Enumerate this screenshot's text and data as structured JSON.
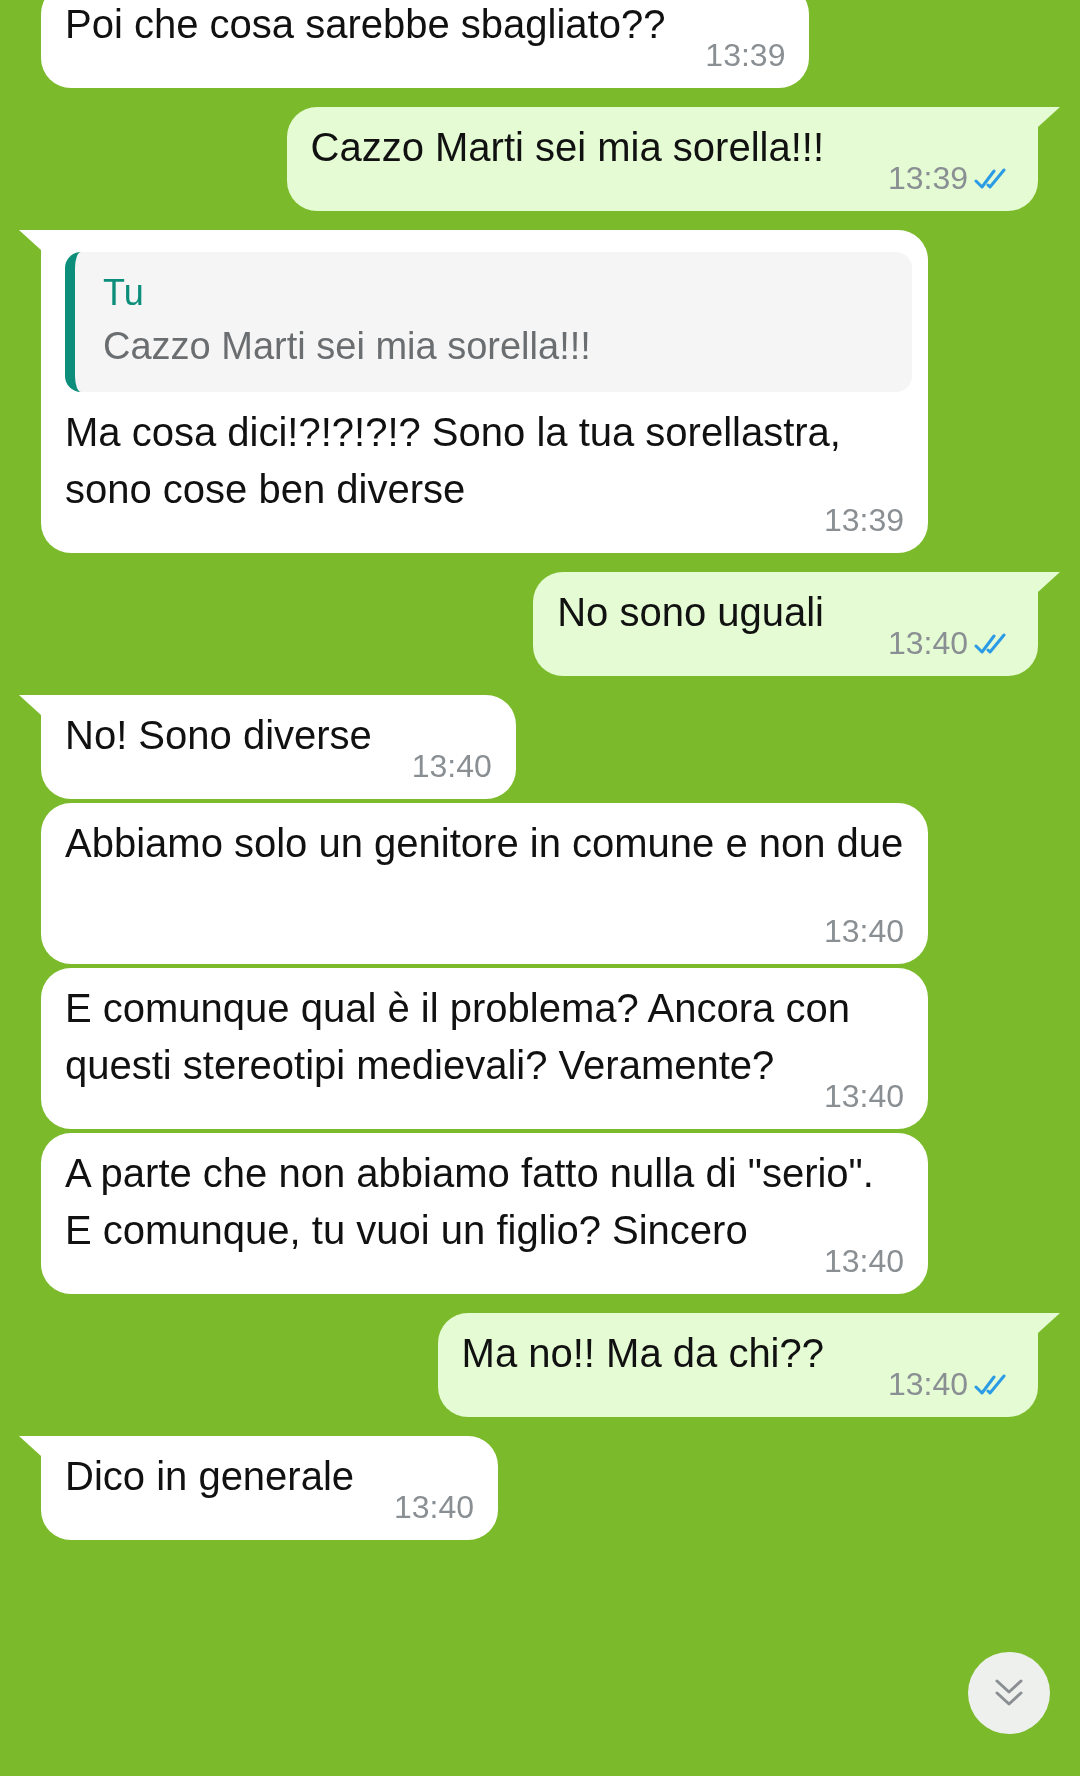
{
  "messages": [
    {
      "kind": "received",
      "tail": false,
      "text": "Poi che cosa sarebbe sbagliato??",
      "time": "13:39"
    },
    {
      "kind": "sent",
      "tail": true,
      "text": "Cazzo Marti sei mia sorella!!!",
      "time": "13:39",
      "read": true
    },
    {
      "kind": "received",
      "tail": true,
      "reply": {
        "author": "Tu",
        "text": "Cazzo Marti sei mia sorella!!!"
      },
      "text": "Ma cosa dici!?!?!?!? Sono la tua sorellastra, sono cose ben diverse",
      "time": "13:39"
    },
    {
      "kind": "sent",
      "tail": true,
      "text": "No sono uguali",
      "time": "13:40",
      "read": true
    },
    {
      "kind": "received",
      "tail": true,
      "text": "No! Sono diverse",
      "time": "13:40"
    },
    {
      "kind": "received",
      "tail": false,
      "text": "Abbiamo solo un genitore in comune e non due",
      "time": "13:40"
    },
    {
      "kind": "received",
      "tail": false,
      "text": "E comunque qual è il problema? Ancora con questi stereotipi medievali? Veramente?",
      "time": "13:40"
    },
    {
      "kind": "received",
      "tail": false,
      "text": "A parte che non abbiamo fatto nulla di \"serio\". E comunque, tu vuoi un figlio? Sincero",
      "time": "13:40"
    },
    {
      "kind": "sent",
      "tail": true,
      "text": "Ma no!! Ma da chi??",
      "time": "13:40",
      "read": true
    },
    {
      "kind": "received",
      "tail": true,
      "text": "Dico in generale",
      "time": "13:40"
    }
  ]
}
